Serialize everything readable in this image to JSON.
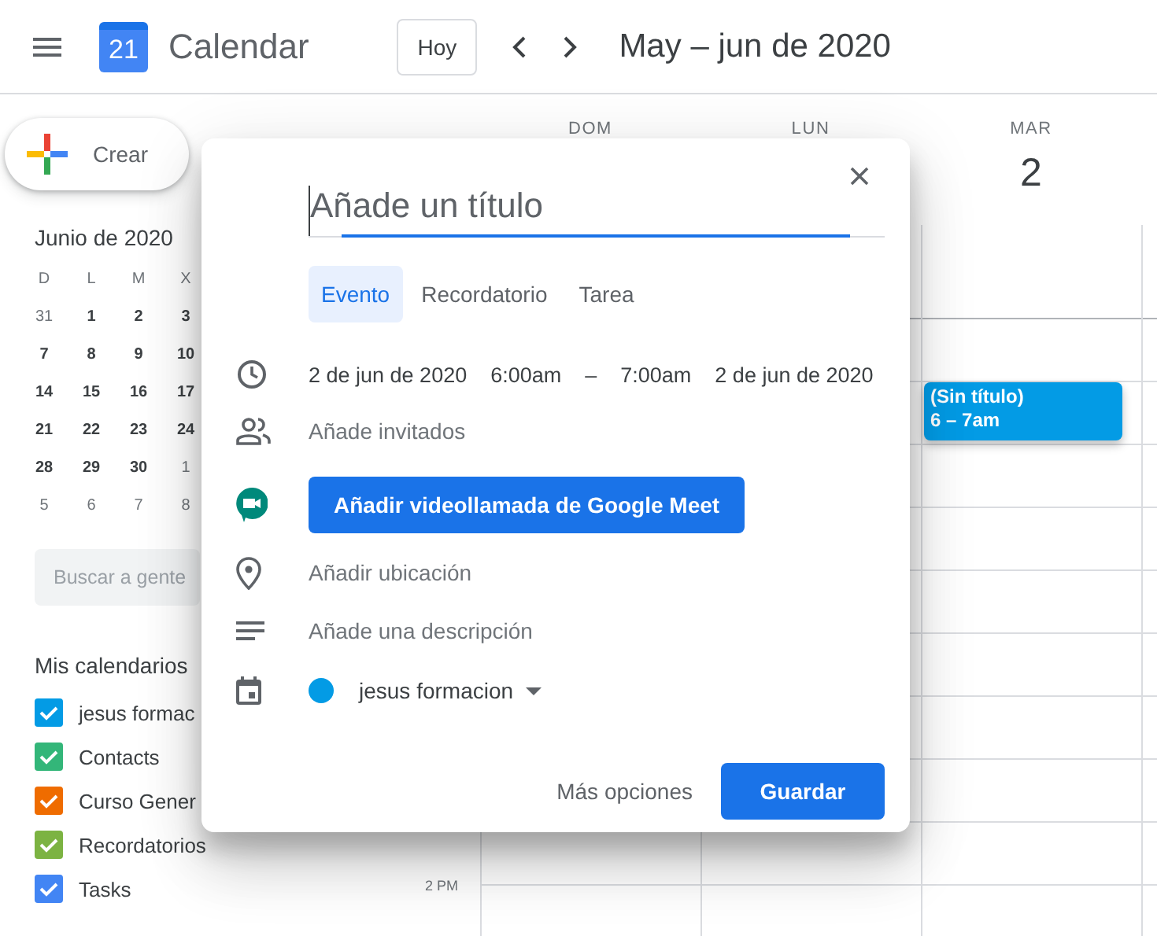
{
  "header": {
    "logo_day": "21",
    "app_name": "Calendar",
    "today_button": "Hoy",
    "date_range": "May – jun de 2020"
  },
  "sidebar": {
    "create_button": "Crear",
    "mini_calendar": {
      "title": "Junio de 2020",
      "weekdays": [
        "D",
        "L",
        "M",
        "X"
      ],
      "weeks": [
        [
          {
            "day": "31",
            "muted": true
          },
          {
            "day": "1",
            "muted": false
          },
          {
            "day": "2",
            "muted": false
          },
          {
            "day": "3",
            "muted": false
          }
        ],
        [
          {
            "day": "7",
            "muted": false
          },
          {
            "day": "8",
            "muted": false
          },
          {
            "day": "9",
            "muted": false
          },
          {
            "day": "10",
            "muted": false
          }
        ],
        [
          {
            "day": "14",
            "muted": false
          },
          {
            "day": "15",
            "muted": false
          },
          {
            "day": "16",
            "muted": false
          },
          {
            "day": "17",
            "muted": false
          }
        ],
        [
          {
            "day": "21",
            "muted": false
          },
          {
            "day": "22",
            "muted": false
          },
          {
            "day": "23",
            "muted": false
          },
          {
            "day": "24",
            "muted": false
          }
        ],
        [
          {
            "day": "28",
            "muted": false
          },
          {
            "day": "29",
            "muted": false
          },
          {
            "day": "30",
            "muted": false
          },
          {
            "day": "1",
            "muted": true
          }
        ],
        [
          {
            "day": "5",
            "muted": true
          },
          {
            "day": "6",
            "muted": true
          },
          {
            "day": "7",
            "muted": true
          },
          {
            "day": "8",
            "muted": true
          }
        ]
      ]
    },
    "search": {
      "placeholder": "Buscar a gente"
    },
    "my_calendars": {
      "title": "Mis calendarios",
      "items": [
        {
          "label": "jesus formac",
          "color": "#039be5",
          "checked": true
        },
        {
          "label": "Contacts",
          "color": "#33b679",
          "checked": true
        },
        {
          "label": "Curso Gener",
          "color": "#ef6c00",
          "checked": true
        },
        {
          "label": "Recordatorios",
          "color": "#7cb342",
          "checked": true
        },
        {
          "label": "Tasks",
          "color": "#4285f4",
          "checked": true
        }
      ]
    }
  },
  "grid": {
    "days": [
      {
        "name": "DOM"
      },
      {
        "name": "LUN"
      },
      {
        "name": "MAR",
        "number": "2"
      }
    ],
    "time_labels": [
      "2 PM"
    ],
    "events": [
      {
        "title": "(Sin título)",
        "time": "6 – 7am",
        "color": "#039be5"
      }
    ]
  },
  "dialog": {
    "title_placeholder": "Añade un título",
    "tabs": [
      {
        "label": "Evento",
        "selected": true
      },
      {
        "label": "Recordatorio",
        "selected": false
      },
      {
        "label": "Tarea",
        "selected": false
      }
    ],
    "start_date": "2 de jun de 2020",
    "start_time": "6:00am",
    "separator": "–",
    "end_time": "7:00am",
    "end_date": "2 de jun de 2020",
    "guests_placeholder": "Añade invitados",
    "meet_button": "Añadir videollamada de Google Meet",
    "location_placeholder": "Añadir ubicación",
    "description_placeholder": "Añade una descripción",
    "calendar": {
      "name": "jesus formacion",
      "color": "#039be5"
    },
    "more_options": "Más opciones",
    "save_button": "Guardar"
  }
}
